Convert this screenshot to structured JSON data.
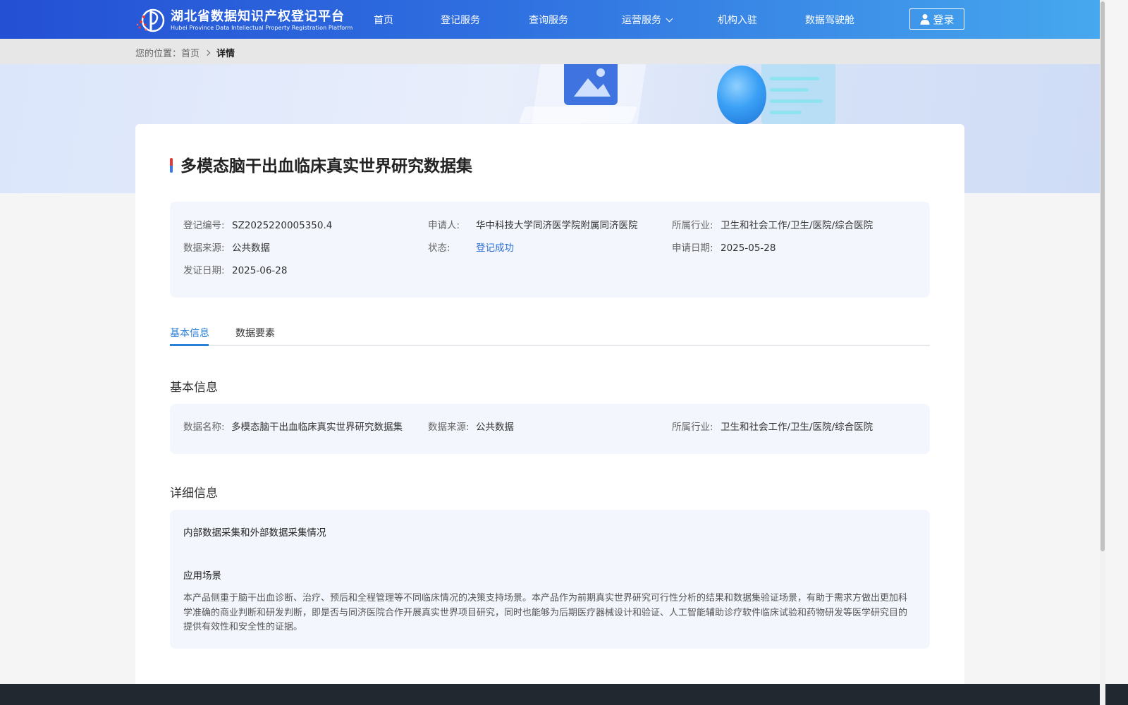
{
  "header": {
    "logo_cn": "湖北省数据知识产权登记平台",
    "logo_en": "Hubei Province Data Intellectual Property Registration Platform",
    "nav": [
      {
        "label": "首页"
      },
      {
        "label": "登记服务"
      },
      {
        "label": "查询服务"
      },
      {
        "label": "运营服务",
        "has_dropdown": true
      },
      {
        "label": "机构入驻"
      },
      {
        "label": "数据驾驶舱"
      }
    ],
    "login_label": "登录",
    "colors": {
      "gradient_start": "#2450d4",
      "gradient_end": "#46a8ee"
    }
  },
  "breadcrumb": {
    "prefix": "您的位置：",
    "home": "首页",
    "current": "详情"
  },
  "detail": {
    "title": "多模态脑干出血临床真实世界研究数据集",
    "summary": {
      "reg_no_label": "登记编号:",
      "reg_no": "SZ2025220005350.4",
      "applicant_label": "申请人:",
      "applicant": "华中科技大学同济医学院附属同济医院",
      "industry_label": "所属行业:",
      "industry": "卫生和社会工作/卫生/医院/综合医院",
      "source_label": "数据来源:",
      "source": "公共数据",
      "status_label": "状态:",
      "status": "登记成功",
      "apply_date_label": "申请日期:",
      "apply_date": "2025-05-28",
      "issue_date_label": "发证日期:",
      "issue_date": "2025-06-28"
    },
    "tabs": [
      {
        "label": "基本信息",
        "active": true
      },
      {
        "label": "数据要素",
        "active": false
      }
    ],
    "basic": {
      "section_title": "基本信息",
      "name_label": "数据名称:",
      "name": "多模态脑干出血临床真实世界研究数据集",
      "source_label": "数据来源:",
      "source": "公共数据",
      "industry_label": "所属行业:",
      "industry": "卫生和社会工作/卫生/医院/综合医院"
    },
    "details": {
      "section_title": "详细信息",
      "collection_heading": "内部数据采集和外部数据采集情况",
      "scenario_heading": "应用场景",
      "scenario_text": "本产品侧重于脑干出血诊断、治疗、预后和全程管理等不同临床情况的决策支持场景。本产品作为前期真实世界研究可行性分析的结果和数据集验证场景，有助于需求方做出更加科学准确的商业判断和研发判断，即是否与同济医院合作开展真实世界项目研究，同时也能够为后期医疗器械设计和验证、人工智能辅助诊疗软件临床试验和药物研发等医学研究目的提供有效性和安全性的证据。"
    }
  },
  "accent_color": "#2a7fd6"
}
